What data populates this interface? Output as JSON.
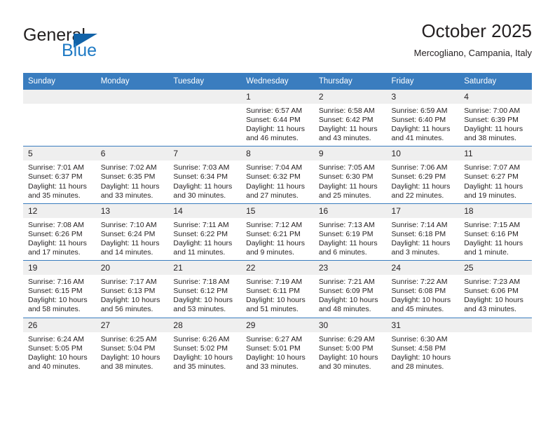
{
  "brand": {
    "name_part1": "General",
    "name_part2": "Blue",
    "accent_color": "#1263a8",
    "text_color": "#221f1f"
  },
  "header": {
    "title": "October 2025",
    "subtitle": "Mercogliano, Campania, Italy"
  },
  "theme": {
    "header_band": "#3a7dbf",
    "daynum_band": "#efefef",
    "text": "#231f20"
  },
  "weekday_headers": [
    "Sunday",
    "Monday",
    "Tuesday",
    "Wednesday",
    "Thursday",
    "Friday",
    "Saturday"
  ],
  "weeks": [
    [
      {
        "day": "",
        "empty": true
      },
      {
        "day": "",
        "empty": true
      },
      {
        "day": "",
        "empty": true
      },
      {
        "day": "1",
        "sunrise": "Sunrise: 6:57 AM",
        "sunset": "Sunset: 6:44 PM",
        "daylight_line1": "Daylight: 11 hours",
        "daylight_line2": "and 46 minutes."
      },
      {
        "day": "2",
        "sunrise": "Sunrise: 6:58 AM",
        "sunset": "Sunset: 6:42 PM",
        "daylight_line1": "Daylight: 11 hours",
        "daylight_line2": "and 43 minutes."
      },
      {
        "day": "3",
        "sunrise": "Sunrise: 6:59 AM",
        "sunset": "Sunset: 6:40 PM",
        "daylight_line1": "Daylight: 11 hours",
        "daylight_line2": "and 41 minutes."
      },
      {
        "day": "4",
        "sunrise": "Sunrise: 7:00 AM",
        "sunset": "Sunset: 6:39 PM",
        "daylight_line1": "Daylight: 11 hours",
        "daylight_line2": "and 38 minutes."
      }
    ],
    [
      {
        "day": "5",
        "sunrise": "Sunrise: 7:01 AM",
        "sunset": "Sunset: 6:37 PM",
        "daylight_line1": "Daylight: 11 hours",
        "daylight_line2": "and 35 minutes."
      },
      {
        "day": "6",
        "sunrise": "Sunrise: 7:02 AM",
        "sunset": "Sunset: 6:35 PM",
        "daylight_line1": "Daylight: 11 hours",
        "daylight_line2": "and 33 minutes."
      },
      {
        "day": "7",
        "sunrise": "Sunrise: 7:03 AM",
        "sunset": "Sunset: 6:34 PM",
        "daylight_line1": "Daylight: 11 hours",
        "daylight_line2": "and 30 minutes."
      },
      {
        "day": "8",
        "sunrise": "Sunrise: 7:04 AM",
        "sunset": "Sunset: 6:32 PM",
        "daylight_line1": "Daylight: 11 hours",
        "daylight_line2": "and 27 minutes."
      },
      {
        "day": "9",
        "sunrise": "Sunrise: 7:05 AM",
        "sunset": "Sunset: 6:30 PM",
        "daylight_line1": "Daylight: 11 hours",
        "daylight_line2": "and 25 minutes."
      },
      {
        "day": "10",
        "sunrise": "Sunrise: 7:06 AM",
        "sunset": "Sunset: 6:29 PM",
        "daylight_line1": "Daylight: 11 hours",
        "daylight_line2": "and 22 minutes."
      },
      {
        "day": "11",
        "sunrise": "Sunrise: 7:07 AM",
        "sunset": "Sunset: 6:27 PM",
        "daylight_line1": "Daylight: 11 hours",
        "daylight_line2": "and 19 minutes."
      }
    ],
    [
      {
        "day": "12",
        "sunrise": "Sunrise: 7:08 AM",
        "sunset": "Sunset: 6:26 PM",
        "daylight_line1": "Daylight: 11 hours",
        "daylight_line2": "and 17 minutes."
      },
      {
        "day": "13",
        "sunrise": "Sunrise: 7:10 AM",
        "sunset": "Sunset: 6:24 PM",
        "daylight_line1": "Daylight: 11 hours",
        "daylight_line2": "and 14 minutes."
      },
      {
        "day": "14",
        "sunrise": "Sunrise: 7:11 AM",
        "sunset": "Sunset: 6:22 PM",
        "daylight_line1": "Daylight: 11 hours",
        "daylight_line2": "and 11 minutes."
      },
      {
        "day": "15",
        "sunrise": "Sunrise: 7:12 AM",
        "sunset": "Sunset: 6:21 PM",
        "daylight_line1": "Daylight: 11 hours",
        "daylight_line2": "and 9 minutes."
      },
      {
        "day": "16",
        "sunrise": "Sunrise: 7:13 AM",
        "sunset": "Sunset: 6:19 PM",
        "daylight_line1": "Daylight: 11 hours",
        "daylight_line2": "and 6 minutes."
      },
      {
        "day": "17",
        "sunrise": "Sunrise: 7:14 AM",
        "sunset": "Sunset: 6:18 PM",
        "daylight_line1": "Daylight: 11 hours",
        "daylight_line2": "and 3 minutes."
      },
      {
        "day": "18",
        "sunrise": "Sunrise: 7:15 AM",
        "sunset": "Sunset: 6:16 PM",
        "daylight_line1": "Daylight: 11 hours",
        "daylight_line2": "and 1 minute."
      }
    ],
    [
      {
        "day": "19",
        "sunrise": "Sunrise: 7:16 AM",
        "sunset": "Sunset: 6:15 PM",
        "daylight_line1": "Daylight: 10 hours",
        "daylight_line2": "and 58 minutes."
      },
      {
        "day": "20",
        "sunrise": "Sunrise: 7:17 AM",
        "sunset": "Sunset: 6:13 PM",
        "daylight_line1": "Daylight: 10 hours",
        "daylight_line2": "and 56 minutes."
      },
      {
        "day": "21",
        "sunrise": "Sunrise: 7:18 AM",
        "sunset": "Sunset: 6:12 PM",
        "daylight_line1": "Daylight: 10 hours",
        "daylight_line2": "and 53 minutes."
      },
      {
        "day": "22",
        "sunrise": "Sunrise: 7:19 AM",
        "sunset": "Sunset: 6:11 PM",
        "daylight_line1": "Daylight: 10 hours",
        "daylight_line2": "and 51 minutes."
      },
      {
        "day": "23",
        "sunrise": "Sunrise: 7:21 AM",
        "sunset": "Sunset: 6:09 PM",
        "daylight_line1": "Daylight: 10 hours",
        "daylight_line2": "and 48 minutes."
      },
      {
        "day": "24",
        "sunrise": "Sunrise: 7:22 AM",
        "sunset": "Sunset: 6:08 PM",
        "daylight_line1": "Daylight: 10 hours",
        "daylight_line2": "and 45 minutes."
      },
      {
        "day": "25",
        "sunrise": "Sunrise: 7:23 AM",
        "sunset": "Sunset: 6:06 PM",
        "daylight_line1": "Daylight: 10 hours",
        "daylight_line2": "and 43 minutes."
      }
    ],
    [
      {
        "day": "26",
        "sunrise": "Sunrise: 6:24 AM",
        "sunset": "Sunset: 5:05 PM",
        "daylight_line1": "Daylight: 10 hours",
        "daylight_line2": "and 40 minutes."
      },
      {
        "day": "27",
        "sunrise": "Sunrise: 6:25 AM",
        "sunset": "Sunset: 5:04 PM",
        "daylight_line1": "Daylight: 10 hours",
        "daylight_line2": "and 38 minutes."
      },
      {
        "day": "28",
        "sunrise": "Sunrise: 6:26 AM",
        "sunset": "Sunset: 5:02 PM",
        "daylight_line1": "Daylight: 10 hours",
        "daylight_line2": "and 35 minutes."
      },
      {
        "day": "29",
        "sunrise": "Sunrise: 6:27 AM",
        "sunset": "Sunset: 5:01 PM",
        "daylight_line1": "Daylight: 10 hours",
        "daylight_line2": "and 33 minutes."
      },
      {
        "day": "30",
        "sunrise": "Sunrise: 6:29 AM",
        "sunset": "Sunset: 5:00 PM",
        "daylight_line1": "Daylight: 10 hours",
        "daylight_line2": "and 30 minutes."
      },
      {
        "day": "31",
        "sunrise": "Sunrise: 6:30 AM",
        "sunset": "Sunset: 4:58 PM",
        "daylight_line1": "Daylight: 10 hours",
        "daylight_line2": "and 28 minutes."
      },
      {
        "day": "",
        "empty": true
      }
    ]
  ]
}
